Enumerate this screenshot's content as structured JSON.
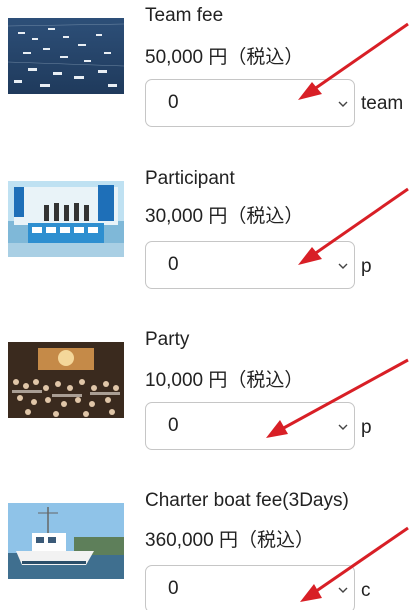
{
  "items": [
    {
      "title": "Team fee",
      "price": "50,000 円（税込）",
      "selected": "0",
      "unit": "team",
      "image_icon": "fleet-of-boats-photo"
    },
    {
      "title": "Participant",
      "price": "30,000 円（税込）",
      "selected": "0",
      "unit": "p",
      "image_icon": "stage-ceremony-photo"
    },
    {
      "title": "Party",
      "price": "10,000 円（税込）",
      "selected": "0",
      "unit": "p",
      "image_icon": "party-hall-photo"
    },
    {
      "title": "Charter boat fee(3Days)",
      "price": "360,000 円（税込）",
      "selected": "0",
      "unit": "c",
      "image_icon": "charter-boat-photo"
    }
  ],
  "colors": {
    "annotation_arrow": "#d81f26",
    "select_border": "#c6c6c6",
    "text": "#222222"
  }
}
